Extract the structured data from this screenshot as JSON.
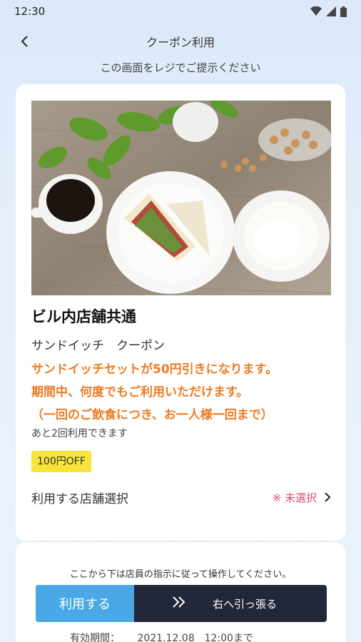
{
  "status_bar": {
    "time": "12:30"
  },
  "nav": {
    "title": "クーポン利用"
  },
  "subtitle": "この画面をレジでご提示ください",
  "coupon": {
    "store_name": "ビル内店舗共通",
    "name": "サンドイッチ　クーポン",
    "description_lines": [
      "サンドイッチセットが50円引きになります。",
      "期間中、何度でもご利用いただけます。",
      "（一回のご飲食につき、お一人様一回まで）"
    ],
    "remaining": "あと2回利用できます",
    "badge": "100円OFF"
  },
  "store_select": {
    "label": "利用する店舗選択",
    "status": "※ 未選択"
  },
  "staff_note": "ここから下は店員の指示に従って操作してください。",
  "swipe": {
    "use_label": "利用する",
    "pull_label": "右へ引っ張る"
  },
  "validity": {
    "label": "有効期間：",
    "value": "2021.12.08　12:00まで"
  },
  "colors": {
    "accent": "#ee7a21",
    "badge": "#f6e43a",
    "button": "#4aa8e6",
    "warning": "#e04a6a"
  }
}
